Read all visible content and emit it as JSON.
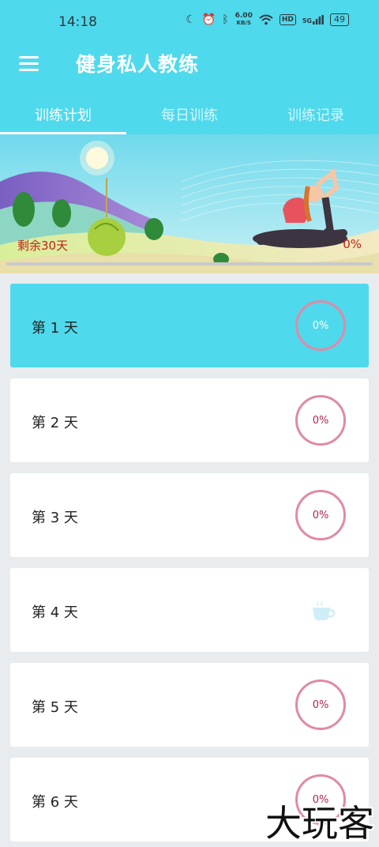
{
  "status_bar": {
    "time": "14:18",
    "net_speed_value": "6.00",
    "net_speed_unit": "KB/S",
    "hd": "HD",
    "signal": "5G",
    "battery": "49"
  },
  "header": {
    "title": "健身私人教练",
    "menu_icon": "hamburger-menu-icon"
  },
  "tabs": [
    {
      "label": "训练计划",
      "active": true
    },
    {
      "label": "每日训练",
      "active": false
    },
    {
      "label": "训练记录",
      "active": false
    }
  ],
  "banner": {
    "remaining": "剩余30天",
    "percent": "0%",
    "progress": 0
  },
  "days": [
    {
      "label": "第 1 天",
      "progress": "0%",
      "active": true,
      "rest": false
    },
    {
      "label": "第 2 天",
      "progress": "0%",
      "active": false,
      "rest": false
    },
    {
      "label": "第 3 天",
      "progress": "0%",
      "active": false,
      "rest": false
    },
    {
      "label": "第 4 天",
      "progress": "",
      "active": false,
      "rest": true
    },
    {
      "label": "第 5 天",
      "progress": "0%",
      "active": false,
      "rest": false
    },
    {
      "label": "第 6 天",
      "progress": "0%",
      "active": false,
      "rest": false
    }
  ],
  "watermark": "大玩客",
  "colors": {
    "accent": "#4fd9ec",
    "ring": "#e08aa6",
    "progress_text": "#c0211a"
  }
}
